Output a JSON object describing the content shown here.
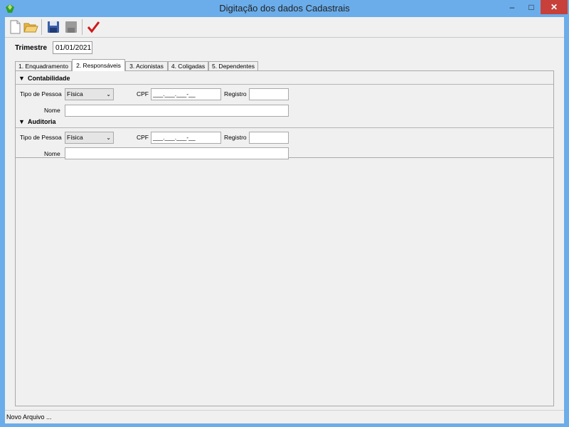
{
  "window": {
    "title": "Digitação dos dados Cadastrais",
    "minimize_glyph": "–",
    "maximize_glyph": "□",
    "close_glyph": "✕"
  },
  "toolbar": {
    "buttons": [
      "new-file-icon",
      "open-folder-icon",
      "save-icon",
      "disabled-save-icon",
      "confirm-check-icon"
    ],
    "check_color": "#d01818"
  },
  "trimestre": {
    "label": "Trimestre",
    "value": "01/01/2021"
  },
  "tabs": [
    {
      "label": "1. Enquadramento",
      "active": false
    },
    {
      "label": "2. Responsáveis",
      "active": true
    },
    {
      "label": "3. Acionistas",
      "active": false
    },
    {
      "label": "4. Coligadas",
      "active": false
    },
    {
      "label": "5. Dependentes",
      "active": false
    }
  ],
  "sections": [
    {
      "title": "Contabilidade",
      "tipo_label": "Tipo de Pessoa",
      "tipo_value": "Física",
      "cpf_label": "CPF",
      "cpf_mask": "___.___.___-__",
      "registro_label": "Registro",
      "registro_value": "",
      "nome_label": "Nome",
      "nome_value": ""
    },
    {
      "title": "Auditoria",
      "tipo_label": "Tipo de Pessoa",
      "tipo_value": "Física",
      "cpf_label": "CPF",
      "cpf_mask": "___.___.___-__",
      "registro_label": "Registro",
      "registro_value": "",
      "nome_label": "Nome",
      "nome_value": ""
    }
  ],
  "status": {
    "text": "Novo Arquivo ..."
  }
}
